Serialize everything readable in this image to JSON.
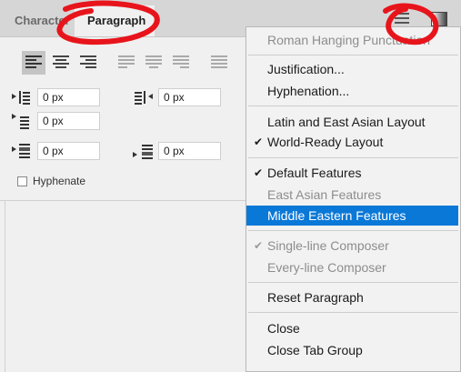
{
  "tabs": [
    {
      "label": "Character",
      "active": false
    },
    {
      "label": "Paragraph",
      "active": true
    }
  ],
  "panel_menu_icon": "hamburger-icon",
  "alignment_buttons": [
    {
      "name": "align-left",
      "selected": true
    },
    {
      "name": "align-center",
      "selected": false
    },
    {
      "name": "align-right",
      "selected": false
    },
    {
      "name": "justify-last-left",
      "selected": false
    },
    {
      "name": "justify-last-center",
      "selected": false
    },
    {
      "name": "justify-last-right",
      "selected": false
    },
    {
      "name": "justify-all",
      "selected": false
    }
  ],
  "fields": {
    "indent_left": "0 px",
    "indent_right": "0 px",
    "indent_first_line": "0 px",
    "space_before": "0 px",
    "space_after": "0 px"
  },
  "hyphenate": {
    "label": "Hyphenate",
    "checked": false
  },
  "menu": {
    "items": [
      {
        "label": "Roman Hanging Punctuation",
        "enabled": false,
        "checked": false
      },
      {
        "label": "Justification...",
        "enabled": true,
        "checked": false
      },
      {
        "label": "Hyphenation...",
        "enabled": true,
        "checked": false
      },
      {
        "label": "Latin and East Asian Layout",
        "enabled": true,
        "checked": false
      },
      {
        "label": "World-Ready Layout",
        "enabled": true,
        "checked": true
      },
      {
        "label": "Default Features",
        "enabled": true,
        "checked": true
      },
      {
        "label": "East Asian Features",
        "enabled": false,
        "checked": false
      },
      {
        "label": "Middle Eastern Features",
        "enabled": true,
        "checked": false,
        "highlighted": true
      },
      {
        "label": "Single-line Composer",
        "enabled": false,
        "checked": true
      },
      {
        "label": "Every-line Composer",
        "enabled": false,
        "checked": false
      },
      {
        "label": "Reset Paragraph",
        "enabled": true,
        "checked": false
      },
      {
        "label": "Close",
        "enabled": true,
        "checked": false
      },
      {
        "label": "Close Tab Group",
        "enabled": true,
        "checked": false
      }
    ],
    "highlight_color": "#0a78d7"
  },
  "colors": {
    "annotation_red": "#e8141b",
    "menu_highlight": "#0a78d7"
  }
}
